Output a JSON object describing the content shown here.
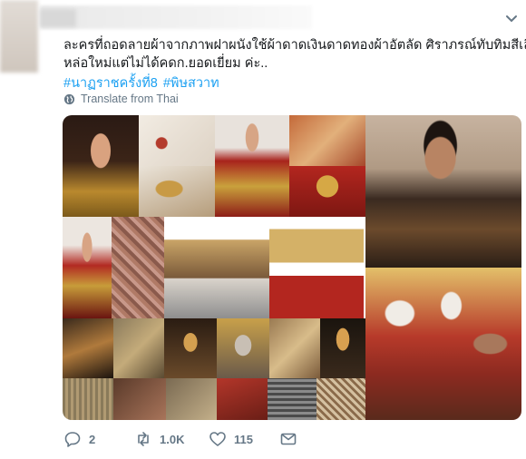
{
  "tweet": {
    "text_lines": [
      "ละครที่ถอดลายผ้าจากภาพฝาผนังใช้ผ้าดาดเงินดาดทองผ้าอัตลัด ศิราภรณ์ทับทิมสีเลือด",
      "หล่อใหม่แต่ไม่ได้คดก.ยอดเยี่ยม ค่ะ.."
    ],
    "hashtags": [
      "#นาฏราชครั้งที่8",
      "#พิษสวาท"
    ],
    "translate_label": "Translate from Thai"
  },
  "actions": {
    "reply_count": "2",
    "retweet_count": "1.0K",
    "like_count": "115"
  },
  "icons": {
    "menu": "chevron-down-icon",
    "translate": "globe-icon",
    "reply": "reply-icon",
    "retweet": "retweet-icon",
    "like": "heart-icon",
    "message": "envelope-icon"
  },
  "colors": {
    "link": "#1da1f2",
    "text": "#14171a",
    "muted": "#657786"
  }
}
